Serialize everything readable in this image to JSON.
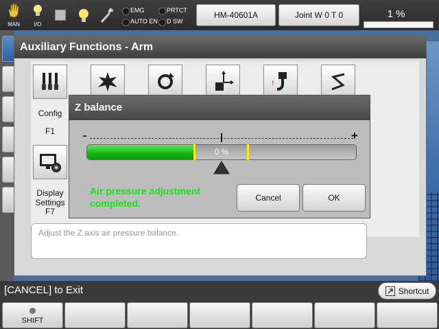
{
  "topbar": {
    "icons": [
      {
        "name": "hand-icon",
        "label": "MAN"
      },
      {
        "name": "io-bulb-icon",
        "label": "I/O"
      }
    ],
    "indicators": [
      {
        "label": "EMG"
      },
      {
        "label": "PRTCT"
      },
      {
        "label": "AUTO EN"
      },
      {
        "label": "D SW"
      }
    ],
    "robot_label": "HM-40601A",
    "joint_label": "Joint  W 0 T 0",
    "speed_text": "1 %"
  },
  "aux_window": {
    "title": "Auxiliary Functions - Arm",
    "functions": [
      {
        "label": "Config",
        "key": "F1",
        "icon": "config-icon"
      },
      {
        "label": "Display Settings",
        "key": "F7",
        "icon": "display-settings-icon"
      }
    ],
    "hint": "Adjust the Z axis air pressure balance."
  },
  "dialog": {
    "title": "Z balance",
    "minus": "-",
    "plus": "+",
    "gauge_text": "0 %",
    "gauge_fill_fraction": 0.4,
    "status": "Air pressure adjustment completed.",
    "cancel_label": "Cancel",
    "ok_label": "OK",
    "colors": {
      "fill": "#10b510",
      "status": "#19e019",
      "marker": "#ffee00"
    }
  },
  "footer": {
    "cancel_hint": "[CANCEL] to Exit",
    "shortcut_label": "Shortcut",
    "keys": [
      {
        "label": "SHIFT"
      },
      {
        "label": ""
      },
      {
        "label": ""
      },
      {
        "label": ""
      },
      {
        "label": ""
      },
      {
        "label": ""
      },
      {
        "label": ""
      }
    ]
  }
}
